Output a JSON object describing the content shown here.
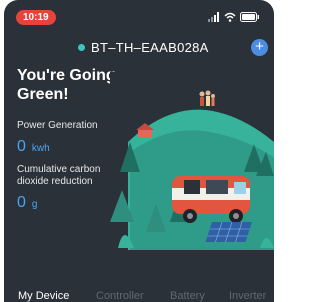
{
  "status_bar": {
    "time": "10:19",
    "icons": [
      "signal-icon",
      "wifi-icon",
      "battery-icon"
    ]
  },
  "header": {
    "device_name": "BT–TH–EAAB028A",
    "connection_status_color": "#3cc7bd",
    "add_symbol": "+"
  },
  "hero": {
    "title": "You're Going Green!",
    "power_generation": {
      "label": "Power Generation",
      "value": "0",
      "unit": "kwh"
    },
    "carbon_reduction": {
      "label": "Cumulative carbon dioxide reduction",
      "value": "0",
      "unit": "g"
    }
  },
  "tabs": [
    {
      "label": "My Device",
      "active": true
    },
    {
      "label": "Controller",
      "active": false
    },
    {
      "label": "Battery",
      "active": false
    },
    {
      "label": "Inverter",
      "active": false
    }
  ],
  "colors": {
    "background": "#2b3138",
    "accent": "#4aa6ef",
    "status_pill": "#e5433c",
    "illustration_teal": "#36b39a"
  }
}
